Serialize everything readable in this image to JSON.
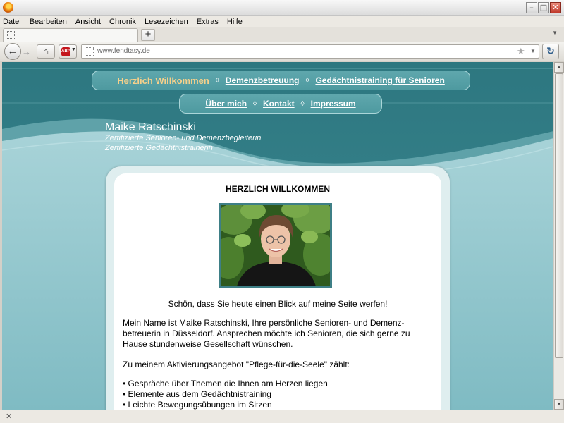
{
  "browser": {
    "menu": [
      "Datei",
      "Bearbeiten",
      "Ansicht",
      "Chronik",
      "Lesezeichen",
      "Extras",
      "Hilfe"
    ],
    "url": "www.fendtasy.de",
    "new_tab_label": "+"
  },
  "nav": {
    "row1": [
      "Herzlich Willkommen",
      "Demenzbetreuung",
      "Gedächtnistraining für Senioren"
    ],
    "row2": [
      "Über mich",
      "Kontakt",
      "Impressum"
    ],
    "separator": "◊"
  },
  "header": {
    "name": "Maike Ratschinski",
    "subtitle_1": "Zertifizierte Senioren- und Demenzbegleiterin",
    "subtitle_2": "Zertifizierte Gedächtnistrainerin"
  },
  "content": {
    "heading": "HERZLICH WILLKOMMEN",
    "welcome": "Schön, dass Sie heute einen Blick auf meine Seite werfen!",
    "intro": "Mein Name ist Maike Ratschinski, Ihre persönliche Senioren- und Demenz-betreuerin in Düsseldorf. Ansprechen möchte ich Senioren, die sich gerne zu Hause stundenweise Gesellschaft wünschen.",
    "offer": "Zu meinem Aktivierungsangebot \"Pflege-für-die-Seele\" zählt:",
    "bullets": [
      "• Gespräche über Themen die Ihnen am Herzen liegen",
      "• Elemente aus dem Gedächtnistraining",
      "• Leichte Bewegungsübungen im Sitzen"
    ]
  },
  "colors": {
    "teal_dark": "#317a83",
    "teal_light": "#8dc3ca",
    "nav_active": "#f7d08a"
  }
}
